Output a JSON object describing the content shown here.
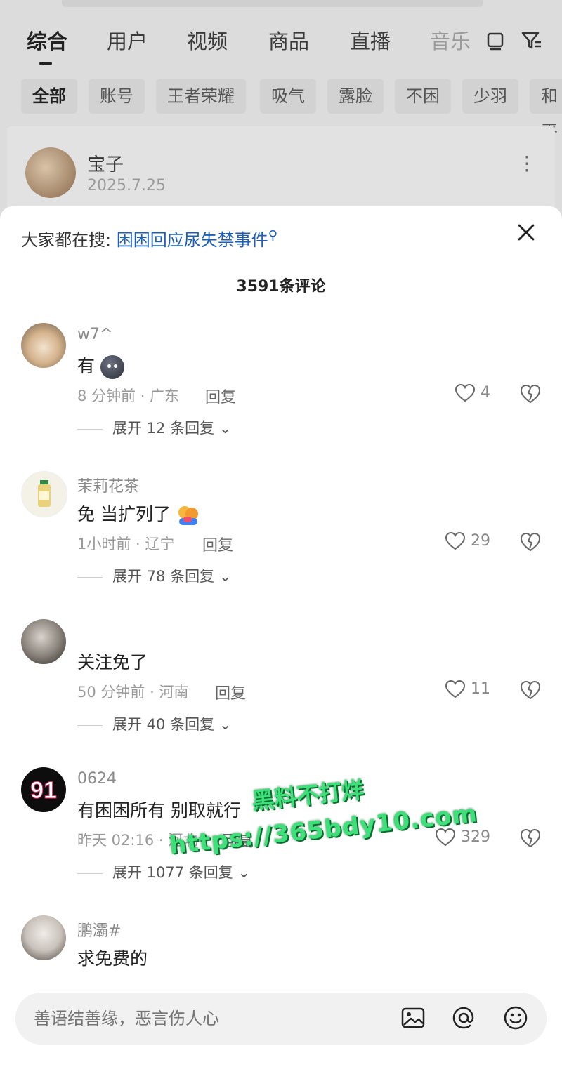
{
  "search_tabs": [
    "综合",
    "用户",
    "视频",
    "商品",
    "直播",
    "音乐"
  ],
  "filter_chips": [
    "全部",
    "账号",
    "王者荣耀",
    "吸气",
    "露脸",
    "不困",
    "少羽",
    "和平"
  ],
  "post": {
    "author": "宝子",
    "date": "2025.7.25"
  },
  "sheet": {
    "hot_prefix": "大家都在搜:",
    "hot_query": "困困回应尿失禁事件",
    "comment_count": "3591条评论"
  },
  "comments": [
    {
      "user": "w7^",
      "text": "有",
      "meta": "8 分钟前 · 广东",
      "reply": "回复",
      "likes": "4",
      "expand": "展开 12 条回复"
    },
    {
      "user": "茉莉花茶",
      "text": "免 当扩列了",
      "meta": "1小时前 · 辽宁",
      "reply": "回复",
      "likes": "29",
      "expand": "展开 78 条回复"
    },
    {
      "user": "",
      "text": "关注免了",
      "meta": "50 分钟前 · 河南",
      "reply": "回复",
      "likes": "11",
      "expand": "展开 40 条回复"
    },
    {
      "user": "0624",
      "text": "有困困所有 别取就行",
      "meta": "昨天 02:16 · 河北",
      "reply": "回复",
      "likes": "329",
      "expand": "展开 1077 条回复"
    },
    {
      "user": "鹏灞#",
      "text": "求免费的",
      "meta": "",
      "reply": "",
      "likes": "",
      "expand": ""
    }
  ],
  "watermark": {
    "line1": "黑料不打烊",
    "line2": "https://365bdy10.com"
  },
  "input": {
    "placeholder": "善语结善缘，恶言伤人心"
  },
  "icons": [
    "image-icon",
    "at-icon",
    "emoji-icon",
    "close-icon",
    "heart-icon",
    "dislike-icon",
    "more-icon",
    "filter-icon",
    "layout-icon"
  ],
  "colors": {
    "accent_link": "#1d5fb8",
    "watermark": "#3ee07a"
  }
}
